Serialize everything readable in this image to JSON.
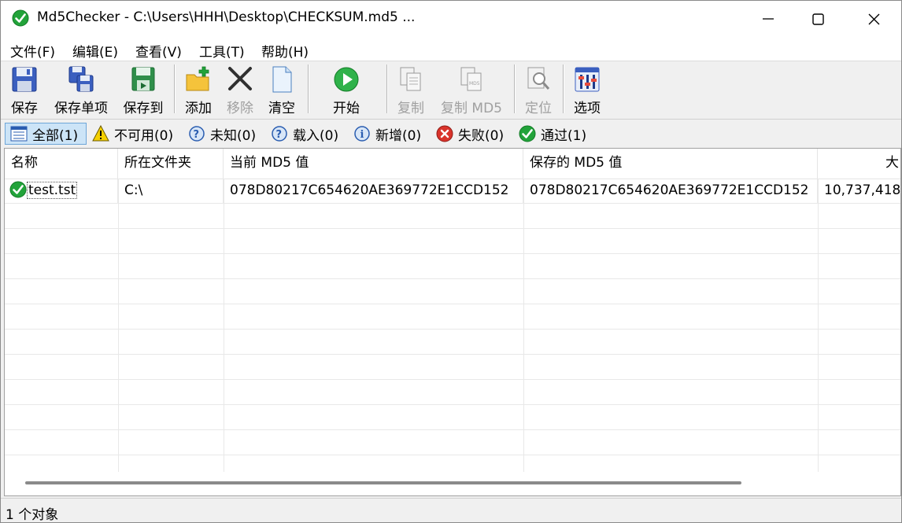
{
  "window": {
    "title": "Md5Checker - C:\\Users\\HHH\\Desktop\\CHECKSUM.md5 ..."
  },
  "menu": [
    {
      "label": "文件(F)"
    },
    {
      "label": "编辑(E)"
    },
    {
      "label": "查看(V)"
    },
    {
      "label": "工具(T)"
    },
    {
      "label": "帮助(H)"
    }
  ],
  "toolbar": {
    "save": "保存",
    "save_item": "保存单项",
    "save_to": "保存到",
    "add": "添加",
    "remove": "移除",
    "clear": "清空",
    "start": "开始",
    "copy": "复制",
    "copy_md5": "复制 MD5",
    "locate": "定位",
    "options": "选项"
  },
  "filters": {
    "all": "全部(1)",
    "unavailable": "不可用(0)",
    "unknown": "未知(0)",
    "loaded": "载入(0)",
    "new": "新增(0)",
    "failed": "失败(0)",
    "passed": "通过(1)"
  },
  "columns": {
    "name": "名称",
    "folder": "所在文件夹",
    "current_md5": "当前 MD5 值",
    "saved_md5": "保存的 MD5 值",
    "size": "大"
  },
  "rows": [
    {
      "name": "test.tst",
      "folder": "C:\\",
      "current_md5": "078D80217C654620AE369772E1CCD152",
      "saved_md5": "078D80217C654620AE369772E1CCD152",
      "size": "10,737,418"
    }
  ],
  "status": {
    "text": "1 个对象"
  },
  "colors": {
    "accent_green": "#22a33a",
    "selected_filter": "#cce4f7"
  }
}
